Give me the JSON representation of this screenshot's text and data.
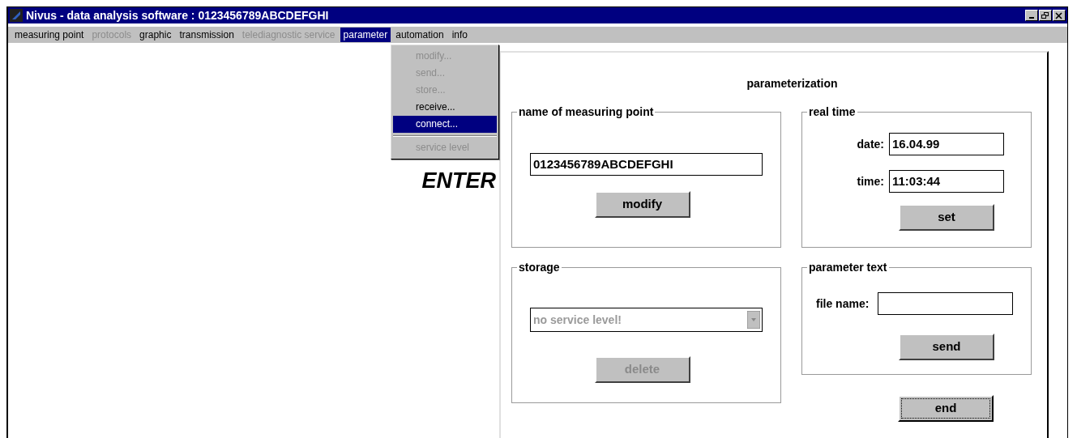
{
  "window": {
    "title": "Nivus - data analysis software : 0123456789ABCDEFGHI"
  },
  "menu": [
    {
      "label": "measuring point",
      "disabled": false,
      "selected": false
    },
    {
      "label": "protocols",
      "disabled": true,
      "selected": false
    },
    {
      "label": "graphic",
      "disabled": false,
      "selected": false
    },
    {
      "label": "transmission",
      "disabled": false,
      "selected": false
    },
    {
      "label": "telediagnostic service",
      "disabled": true,
      "selected": false
    },
    {
      "label": "parameter",
      "disabled": false,
      "selected": true
    },
    {
      "label": "automation",
      "disabled": false,
      "selected": false
    },
    {
      "label": "info",
      "disabled": false,
      "selected": false
    }
  ],
  "dropdown": [
    {
      "kind": "item",
      "label": "modify...",
      "disabled": true,
      "selected": false
    },
    {
      "kind": "item",
      "label": "send...",
      "disabled": true,
      "selected": false
    },
    {
      "kind": "item",
      "label": "store...",
      "disabled": true,
      "selected": false
    },
    {
      "kind": "item",
      "label": "receive...",
      "disabled": false,
      "selected": false
    },
    {
      "kind": "item",
      "label": "connect...",
      "disabled": false,
      "selected": true
    },
    {
      "kind": "separator"
    },
    {
      "kind": "item",
      "label": "service level",
      "disabled": true,
      "selected": false
    }
  ],
  "enter_text": "ENTER",
  "dialog": {
    "title": "parameterization",
    "name_group": {
      "title": "name of measuring point",
      "value": "0123456789ABCDEFGHI",
      "button": {
        "label": "modify",
        "disabled": false
      }
    },
    "time_group": {
      "title": "real time",
      "date_label": "date:",
      "date": "16.04.99",
      "time_label": "time:",
      "time": "11:03:44",
      "button": {
        "label": "set",
        "disabled": false
      }
    },
    "storage_group": {
      "title": "storage",
      "select": {
        "value": "no service level!",
        "disabled": true
      },
      "button": {
        "label": "delete",
        "disabled": true
      }
    },
    "text_group": {
      "title": "parameter text",
      "file_label": "file name:",
      "button": {
        "label": "send",
        "disabled": false
      }
    },
    "end_button": {
      "label": "end",
      "disabled": false
    }
  }
}
